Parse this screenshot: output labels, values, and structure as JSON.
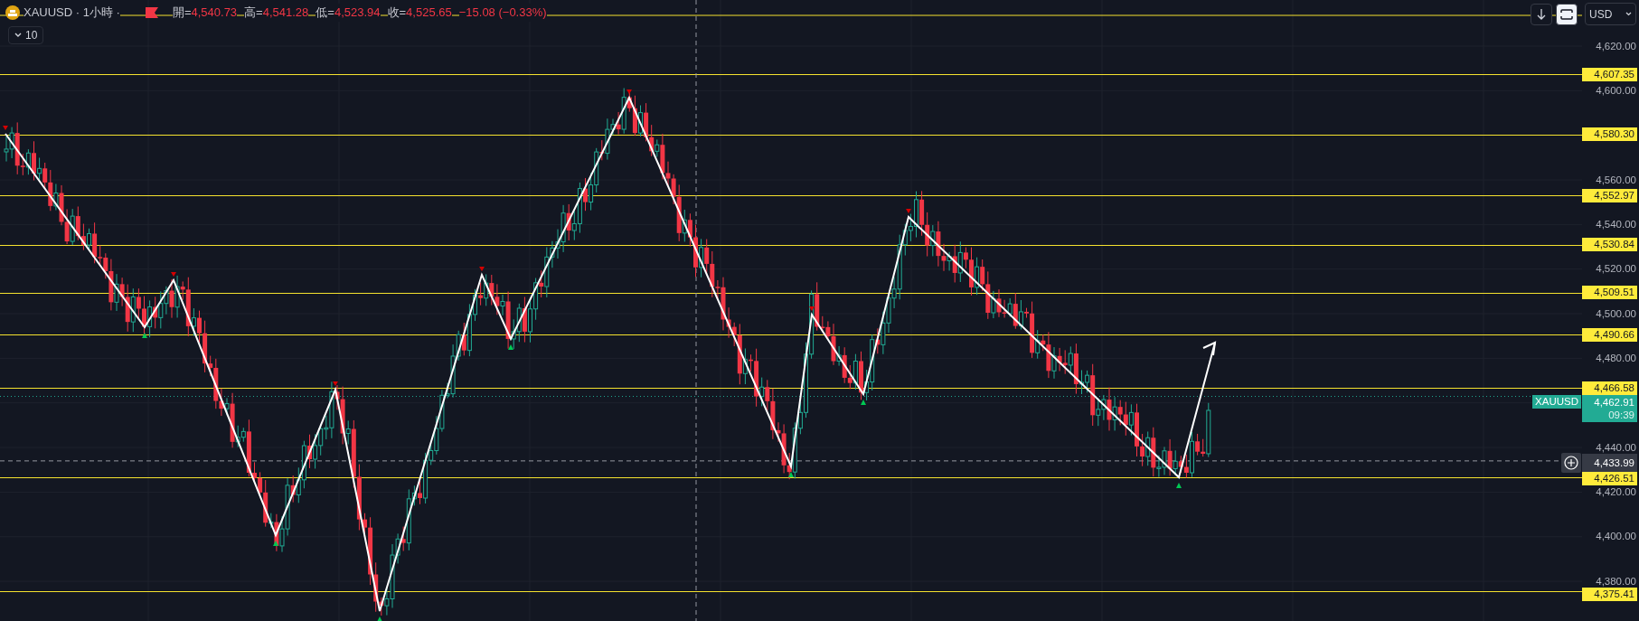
{
  "header": {
    "title": "XAUUSD · 1小時 ·",
    "ohlc": [
      {
        "label": "開=",
        "value": "4,540.73"
      },
      {
        "label": "高=",
        "value": "4,541.28"
      },
      {
        "label": "低=",
        "value": "4,523.94"
      },
      {
        "label": "收=",
        "value": "4,525.65"
      }
    ],
    "change": "−15.08 (−0.33%)"
  },
  "indicator_toggle": {
    "label": "10"
  },
  "toolbar": {
    "currency": "USD"
  },
  "price_axis": {
    "ticks": [
      "4,620.00",
      "4,600.00",
      "4,560.00",
      "4,540.00",
      "4,520.00",
      "4,500.00",
      "4,480.00",
      "4,440.00",
      "4,420.00",
      "4,400.00",
      "4,380.00"
    ]
  },
  "levels": [
    {
      "price": "4,607.35"
    },
    {
      "price": "4,580.30"
    },
    {
      "price": "4,552.97"
    },
    {
      "price": "4,530.84"
    },
    {
      "price": "4,509.51"
    },
    {
      "price": "4,490.66"
    },
    {
      "price": "4,466.58"
    },
    {
      "price": "4,426.51"
    },
    {
      "price": "4,375.41"
    }
  ],
  "current_price": {
    "symbol": "XAUUSD",
    "price": "4,462.91",
    "countdown": "09:39"
  },
  "crosshair": {
    "price": "4,433.99"
  }
}
